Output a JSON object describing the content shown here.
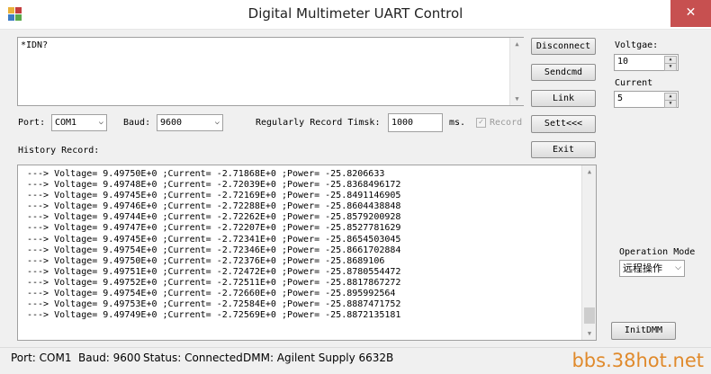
{
  "window": {
    "title": "Digital Multimeter UART Control",
    "close_glyph": "✕"
  },
  "command": {
    "text": "*IDN?"
  },
  "buttons": {
    "disconnect": "Disconnect",
    "sendcmd": "Sendcmd",
    "link": "Link",
    "sett": "Sett<<<",
    "exit": "Exit",
    "initdmm": "InitDMM"
  },
  "settings": {
    "port_label": "Port:",
    "port_value": "COM1",
    "baud_label": "Baud:",
    "baud_value": "9600",
    "record_time_label": "Regularly Record Timsk:",
    "record_time_value": "1000",
    "record_time_unit": "ms.",
    "record_checkbox_label": "Record",
    "record_checked": true
  },
  "history": {
    "label": "History Record:",
    "lines": [
      "---> Voltage= 9.49750E+0 ;Current= -2.71868E+0 ;Power= -25.8206633",
      "---> Voltage= 9.49748E+0 ;Current= -2.72039E+0 ;Power= -25.8368496172",
      "---> Voltage= 9.49745E+0 ;Current= -2.72169E+0 ;Power= -25.8491146905",
      "---> Voltage= 9.49746E+0 ;Current= -2.72288E+0 ;Power= -25.8604438848",
      "---> Voltage= 9.49744E+0 ;Current= -2.72262E+0 ;Power= -25.8579200928",
      "---> Voltage= 9.49747E+0 ;Current= -2.72207E+0 ;Power= -25.8527781629",
      "---> Voltage= 9.49745E+0 ;Current= -2.72341E+0 ;Power= -25.8654503045",
      "---> Voltage= 9.49754E+0 ;Current= -2.72346E+0 ;Power= -25.8661702884",
      "---> Voltage= 9.49750E+0 ;Current= -2.72376E+0 ;Power= -25.8689106",
      "---> Voltage= 9.49751E+0 ;Current= -2.72472E+0 ;Power= -25.8780554472",
      "---> Voltage= 9.49752E+0 ;Current= -2.72511E+0 ;Power= -25.8817867272",
      "---> Voltage= 9.49754E+0 ;Current= -2.72660E+0 ;Power= -25.895992564",
      "---> Voltage= 9.49753E+0 ;Current= -2.72584E+0 ;Power= -25.8887471752",
      "---> Voltage= 9.49749E+0 ;Current= -2.72569E+0 ;Power= -25.8872135181"
    ]
  },
  "right_panel": {
    "voltage_label": "Voltgae:",
    "voltage_value": "10",
    "current_label": "Current",
    "current_value": "5",
    "operation_mode_label": "Operation Mode",
    "operation_mode_value": "远程操作"
  },
  "status_bar": {
    "port": "Port: COM1",
    "baud": "Baud: 9600",
    "status": "Status: Connected",
    "dmm": "DMM: Agilent Supply 6632B"
  },
  "watermark": "bbs.38hot.net",
  "colors": {
    "close": "#c75050",
    "watermark": "#e08a2c"
  }
}
